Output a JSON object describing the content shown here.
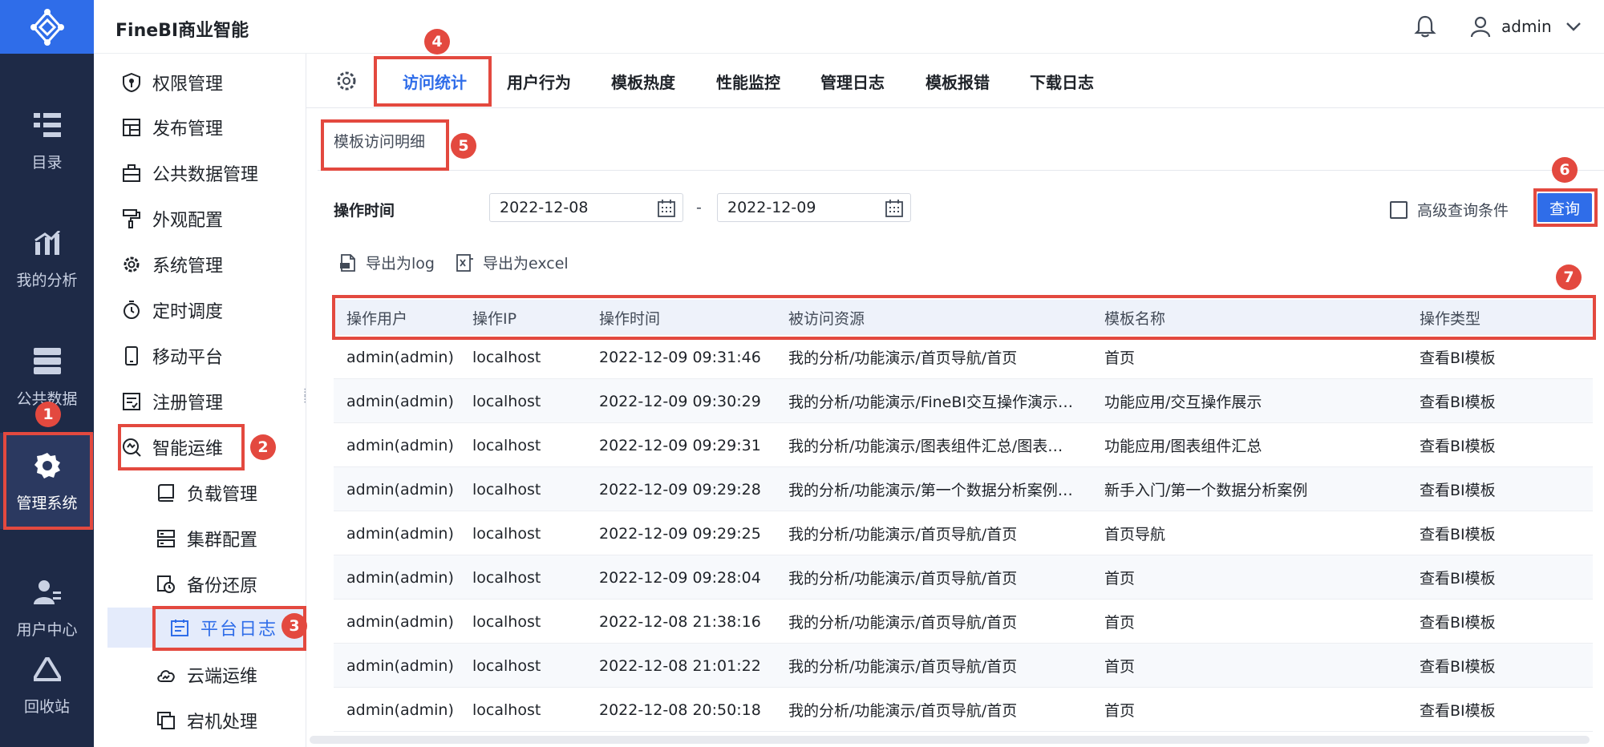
{
  "app": {
    "brand": "FineBI商业智能",
    "user": "admin"
  },
  "rail": [
    {
      "label": "目录",
      "icon": "catalog-icon"
    },
    {
      "label": "我的分析",
      "icon": "analysis-icon"
    },
    {
      "label": "公共数据",
      "icon": "database-icon"
    },
    {
      "label": "管理系统",
      "icon": "gear-icon",
      "active": true
    },
    {
      "label": "用户中心",
      "icon": "user-center-icon"
    },
    {
      "label": "回收站",
      "icon": "recycle-icon"
    }
  ],
  "sidebar": {
    "items": [
      {
        "label": "权限管理",
        "icon": "shield-icon"
      },
      {
        "label": "发布管理",
        "icon": "publish-icon"
      },
      {
        "label": "公共数据管理",
        "icon": "briefcase-icon"
      },
      {
        "label": "外观配置",
        "icon": "brush-icon"
      },
      {
        "label": "系统管理",
        "icon": "gear-icon"
      },
      {
        "label": "定时调度",
        "icon": "timer-icon"
      },
      {
        "label": "移动平台",
        "icon": "phone-icon"
      },
      {
        "label": "注册管理",
        "icon": "register-icon"
      },
      {
        "label": "智能运维",
        "icon": "ops-icon"
      }
    ],
    "subitems": [
      {
        "label": "负载管理",
        "icon": "book-icon"
      },
      {
        "label": "集群配置",
        "icon": "server-icon"
      },
      {
        "label": "备份还原",
        "icon": "backup-icon"
      },
      {
        "label": "平台日志",
        "icon": "calendar-icon",
        "active": true
      },
      {
        "label": "云端运维",
        "icon": "cloud-icon"
      },
      {
        "label": "宕机处理",
        "icon": "copy-icon"
      }
    ]
  },
  "tabs": [
    "访问统计",
    "用户行为",
    "模板热度",
    "性能监控",
    "管理日志",
    "模板报错",
    "下载日志"
  ],
  "subtab": "模板访问明细",
  "filter": {
    "label": "操作时间",
    "start": "2022-12-08",
    "end": "2022-12-09",
    "dash": "-",
    "advanced": "高级查询条件",
    "query": "查询"
  },
  "exports": {
    "log": "导出为log",
    "excel": "导出为excel"
  },
  "table": {
    "columns": [
      "操作用户",
      "操作IP",
      "操作时间",
      "被访问资源",
      "模板名称",
      "操作类型"
    ],
    "rows": [
      [
        "admin(admin)",
        "localhost",
        "2022-12-09 09:31:46",
        "我的分析/功能演示/首页导航/首页",
        "首页",
        "查看BI模板"
      ],
      [
        "admin(admin)",
        "localhost",
        "2022-12-09 09:30:29",
        "我的分析/功能演示/FineBI交互操作演示…",
        "功能应用/交互操作展示",
        "查看BI模板"
      ],
      [
        "admin(admin)",
        "localhost",
        "2022-12-09 09:29:31",
        "我的分析/功能演示/图表组件汇总/图表…",
        "功能应用/图表组件汇总",
        "查看BI模板"
      ],
      [
        "admin(admin)",
        "localhost",
        "2022-12-09 09:29:28",
        "我的分析/功能演示/第一个数据分析案例…",
        "新手入门/第一个数据分析案例",
        "查看BI模板"
      ],
      [
        "admin(admin)",
        "localhost",
        "2022-12-09 09:29:25",
        "我的分析/功能演示/首页导航/首页",
        "首页导航",
        "查看BI模板"
      ],
      [
        "admin(admin)",
        "localhost",
        "2022-12-09 09:28:04",
        "我的分析/功能演示/首页导航/首页",
        "首页",
        "查看BI模板"
      ],
      [
        "admin(admin)",
        "localhost",
        "2022-12-08 21:38:16",
        "我的分析/功能演示/首页导航/首页",
        "首页",
        "查看BI模板"
      ],
      [
        "admin(admin)",
        "localhost",
        "2022-12-08 21:01:22",
        "我的分析/功能演示/首页导航/首页",
        "首页",
        "查看BI模板"
      ],
      [
        "admin(admin)",
        "localhost",
        "2022-12-08 20:50:18",
        "我的分析/功能演示/首页导航/首页",
        "首页",
        "查看BI模板"
      ]
    ]
  },
  "annotations": [
    "1",
    "2",
    "3",
    "4",
    "5",
    "6",
    "7"
  ],
  "colors": {
    "accent": "#2f6de9",
    "rail": "#1e2a47",
    "annotation": "#e3493f"
  }
}
